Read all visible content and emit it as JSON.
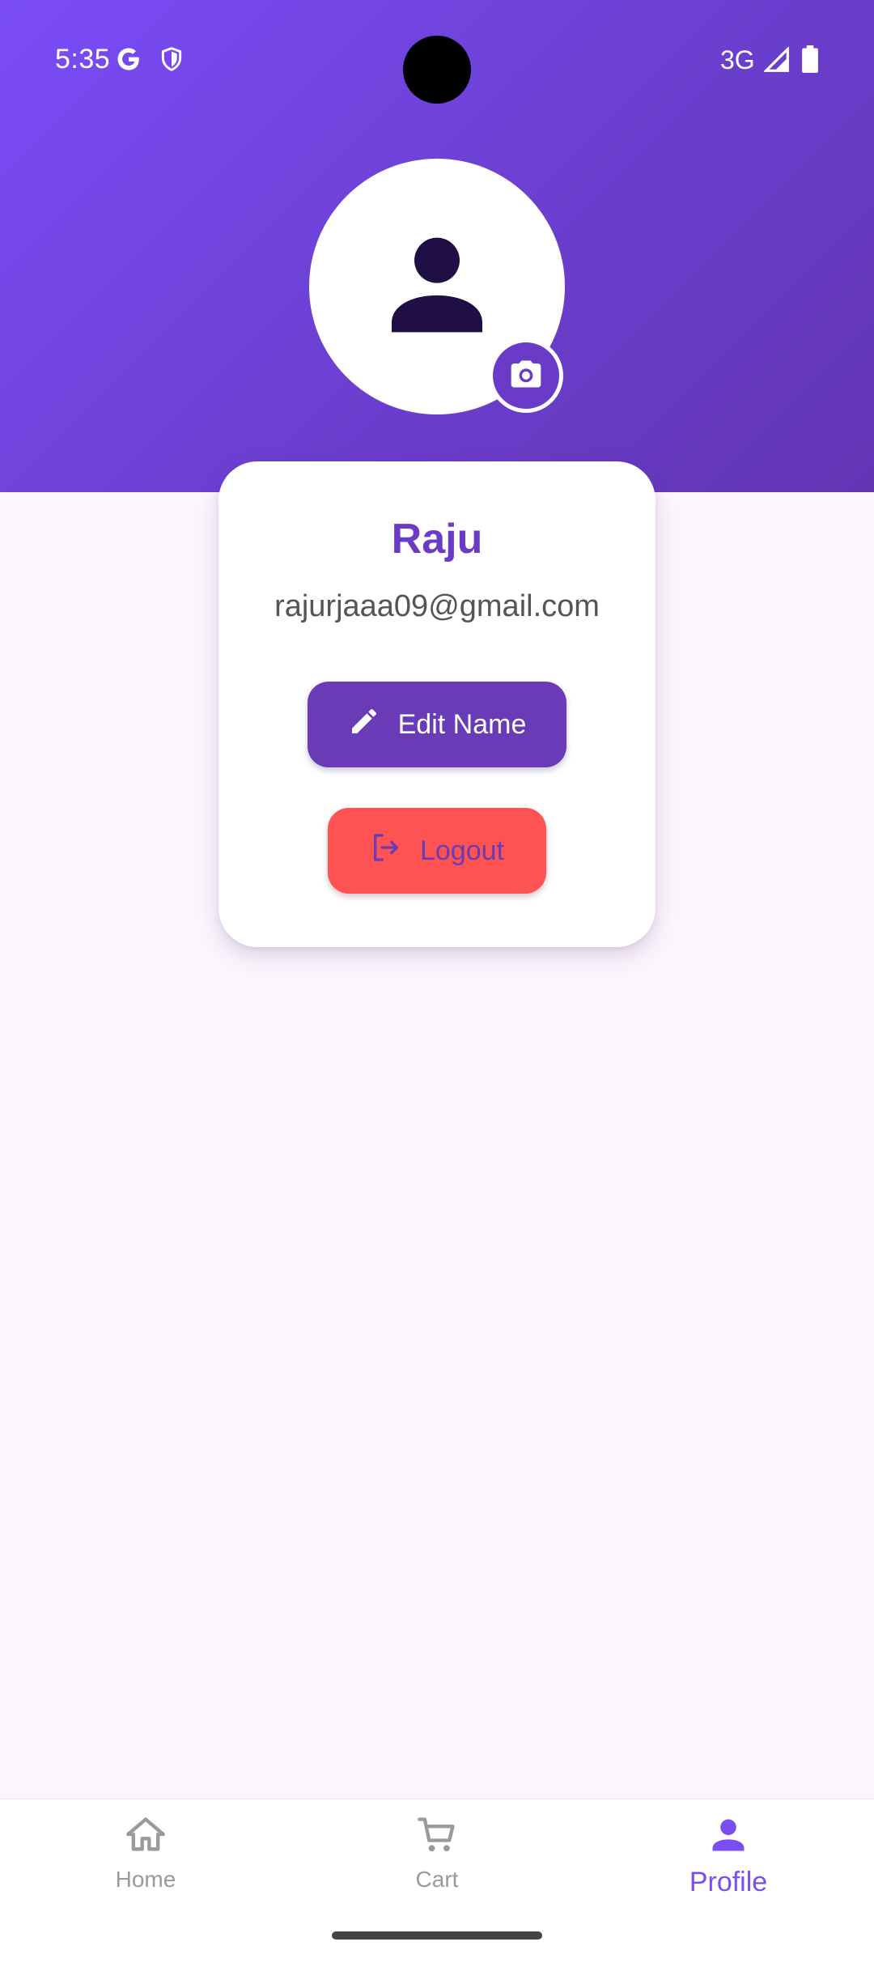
{
  "status_bar": {
    "time": "5:35",
    "network": "3G",
    "icons": [
      "google-icon",
      "shield-icon",
      "signal-icon",
      "battery-icon"
    ]
  },
  "profile": {
    "avatar_icon": "person-icon",
    "camera_icon": "camera-icon",
    "name": "Raju",
    "email": "rajurjaaa09@gmail.com"
  },
  "actions": {
    "edit_name_label": "Edit Name",
    "edit_icon": "pencil-icon",
    "logout_label": "Logout",
    "logout_icon": "logout-icon"
  },
  "bottom_nav": {
    "items": [
      {
        "label": "Home",
        "icon": "home-icon",
        "active": false
      },
      {
        "label": "Cart",
        "icon": "cart-icon",
        "active": false
      },
      {
        "label": "Profile",
        "icon": "person-icon",
        "active": true
      }
    ]
  },
  "colors": {
    "primary": "#6a3bc6",
    "header_gradient_start": "#7b4cf7",
    "header_gradient_end": "#6235b4",
    "logout": "#ff5252",
    "background": "#fcf5fd",
    "active_nav": "#7a4ef0"
  }
}
